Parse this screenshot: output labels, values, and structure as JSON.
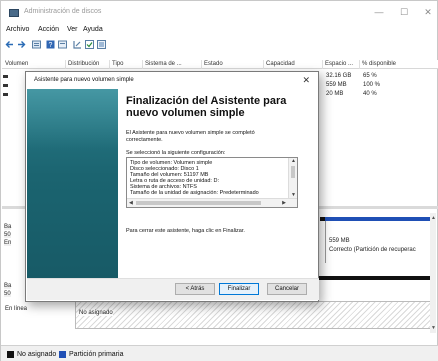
{
  "window": {
    "title": "Administración de discos",
    "controls": {
      "minimize": "—",
      "maximize": "☐",
      "close": "✕"
    }
  },
  "menu": [
    "Archivo",
    "Acción",
    "Ver",
    "Ayuda"
  ],
  "toolbar_icons": [
    "back-icon",
    "forward-icon",
    "list-view-icon",
    "help-icon",
    "properties-icon",
    "undo-icon",
    "check-icon",
    "refresh-icon"
  ],
  "columns": [
    "Volumen",
    "Distribución",
    "Tipo",
    "Sistema de ...",
    "Estado",
    "Capacidad",
    "Espacio ...",
    "% disponible"
  ],
  "volume_rows": [
    {
      "space": "32.16 GB",
      "pct": "65 %"
    },
    {
      "space": "559 MB",
      "pct": "100 %"
    },
    {
      "space": "20 MB",
      "pct": "40 %"
    }
  ],
  "disk_area": {
    "disk1_labels": [
      "Ba",
      "50",
      "En"
    ],
    "disk1_partition": {
      "size": "559 MB",
      "status": "Correcto (Partición de recuperac"
    },
    "disk2_labels": [
      "Ba",
      "50"
    ],
    "disk2_state": "En línea",
    "disk2_unallocated": "No asignado"
  },
  "legend": [
    {
      "label": "No asignado",
      "color": "#111111"
    },
    {
      "label": "Partición primaria",
      "color": "#1f4fb5"
    }
  ],
  "dialog": {
    "title": "Asistente para nuevo volumen simple",
    "heading_line1": "Finalización del Asistente para",
    "heading_line2": "nuevo volumen simple",
    "intro_line1": "El Asistente para nuevo volumen simple se completó",
    "intro_line2": "correctamente.",
    "config_label": "Se seleccionó la siguiente configuración:",
    "config_lines": [
      "Tipo de volumen: Volumen simple",
      "Disco seleccionado: Disco 1",
      "Tamaño del volumen: 51197 MB",
      "Letra o ruta de acceso de unidad: D:",
      "Sistema de archivos: NTFS",
      "Tamaño de la unidad de asignación: Predeterminado"
    ],
    "finish_note": "Para cerrar este asistente, haga clic en Finalizar.",
    "buttons": {
      "back": "< Atrás",
      "finish": "Finalizar",
      "cancel": "Cancelar"
    }
  }
}
